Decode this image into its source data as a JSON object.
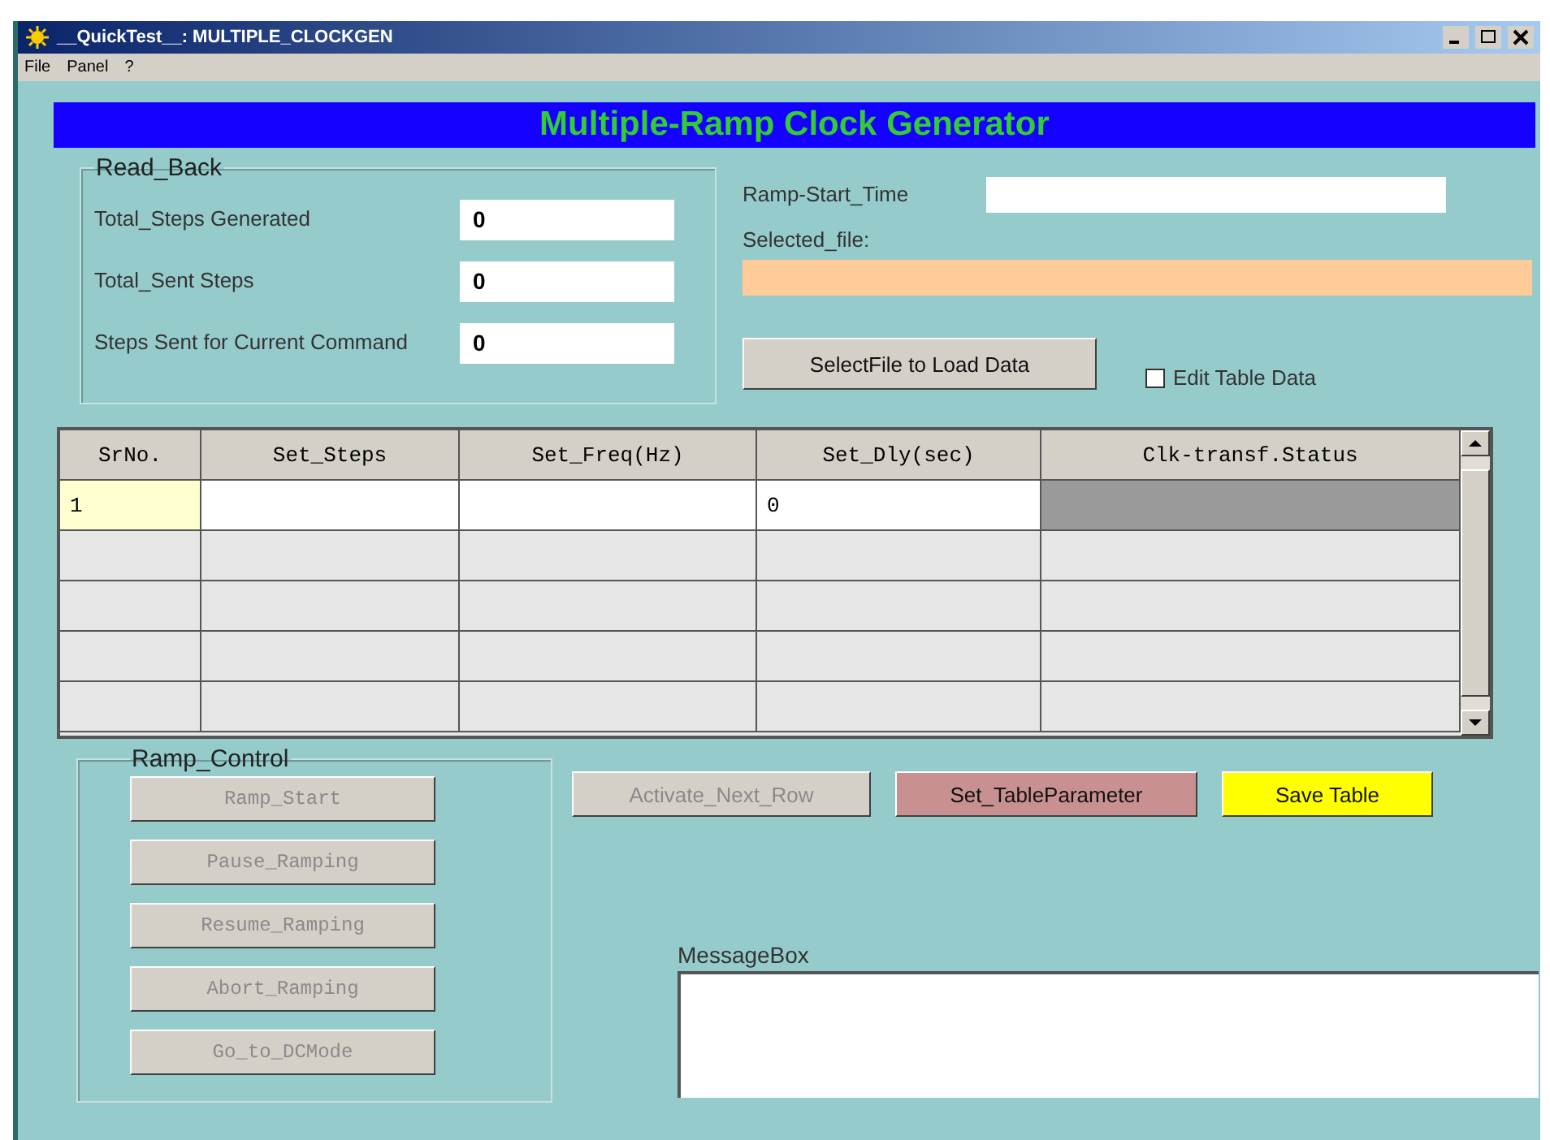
{
  "window": {
    "title": "__QuickTest__: MULTIPLE_CLOCKGEN"
  },
  "menu": [
    "File",
    "Panel",
    "?"
  ],
  "banner": "Multiple-Ramp Clock Generator",
  "read_back": {
    "title": "Read_Back",
    "fields": [
      {
        "label": "Total_Steps Generated",
        "value": "0"
      },
      {
        "label": "Total_Sent Steps",
        "value": "0"
      },
      {
        "label": "Steps Sent for Current Command",
        "value": "0"
      }
    ]
  },
  "ramp_start_time": {
    "label": "Ramp-Start_Time"
  },
  "selected_file": {
    "label": "Selected_file:"
  },
  "select_file_button": "SelectFile to Load Data",
  "edit_table_checkbox": {
    "label": "Edit Table Data",
    "checked": false
  },
  "table": {
    "columns": [
      "SrNo.",
      "Set_Steps",
      "Set_Freq(Hz)",
      "Set_Dly(sec)",
      "Clk-transf.Status"
    ],
    "rows": [
      {
        "active": true,
        "srno": "1",
        "set_dly": "0"
      },
      {
        "active": false
      },
      {
        "active": false
      },
      {
        "active": false
      },
      {
        "active": false
      }
    ]
  },
  "ramp_control": {
    "title": "Ramp_Control",
    "buttons": [
      {
        "label": "Ramp_Start",
        "disabled": true
      },
      {
        "label": "Pause_Ramping",
        "disabled": true
      },
      {
        "label": "Resume_Ramping",
        "disabled": true
      },
      {
        "label": "Abort_Ramping",
        "disabled": true
      },
      {
        "label": "Go_to_DCMode",
        "disabled": true
      }
    ]
  },
  "table_buttons": [
    {
      "label": "Activate_Next_Row",
      "disabled": true,
      "color": "#d4d0c8"
    },
    {
      "label": "Set_TableParameter",
      "disabled": false,
      "color": "#c89090"
    },
    {
      "label": "Save Table",
      "disabled": false,
      "color": "#ffff00"
    }
  ],
  "message_box": {
    "label": "MessageBox"
  }
}
